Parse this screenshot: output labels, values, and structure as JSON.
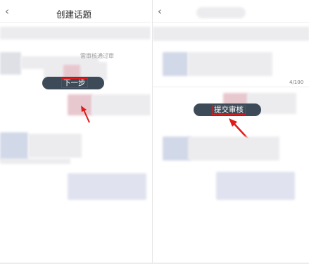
{
  "left_screen": {
    "back_glyph": "‹",
    "title": "创建话题",
    "next_button_label": "下一步",
    "faint_text": "需审核通过审"
  },
  "right_screen": {
    "back_glyph": "‹",
    "char_counter": "4/100",
    "submit_button_label": "提交审核"
  },
  "colors": {
    "pill_bg": "#3d4a57",
    "highlight_red": "#e01b1b"
  },
  "icons": [
    "back-arrow-icon",
    "annotation-arrow-icon"
  ]
}
